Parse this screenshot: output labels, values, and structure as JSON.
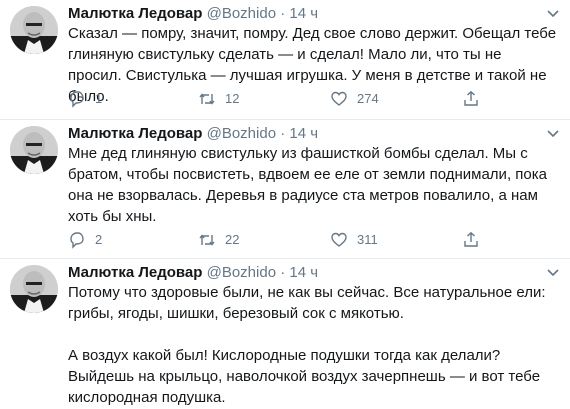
{
  "colors": {
    "text": "#14171a",
    "muted": "#657786",
    "divider": "#e6ecf0"
  },
  "tweets": [
    {
      "author_name": "Малютка Ледовар",
      "handle": "@Bozhido",
      "separator": "·",
      "time": "14 ч",
      "text": "Сказал — помру, значит, помру. Дед свое слово держит. Обещал тебе глиняную свистульку сделать — и сделал! Мало ли, что ты не просил. Свистулька — лучшая игрушка. У меня в детстве и такой не было.",
      "replies": "1",
      "retweets": "12",
      "likes": "274"
    },
    {
      "author_name": "Малютка Ледовар",
      "handle": "@Bozhido",
      "separator": "·",
      "time": "14 ч",
      "text": "Мне дед глиняную свистульку из фашисткой бомбы сделал. Мы с братом, чтобы посвистеть, вдвоем ее еле от земли поднимали, пока она не взорвалась. Деревья в радиусе ста метров повалило, а нам хоть бы хны.",
      "replies": "2",
      "retweets": "22",
      "likes": "311"
    },
    {
      "author_name": "Малютка Ледовар",
      "handle": "@Bozhido",
      "separator": "·",
      "time": "14 ч",
      "text": "Потому что здоровые были, не как вы сейчас. Все натуральное ели: грибы, ягоды, шишки, березовый сок с мякотью.\n\nА воздух какой был! Кислородные подушки тогда как делали? Выйдешь на крыльцо, наволочкой воздух зачерпнешь — и вот тебе кислородная подушка."
    }
  ],
  "icons": {
    "reply": "reply-icon",
    "retweet": "retweet-icon",
    "like": "heart-icon",
    "share": "share-icon",
    "menu": "chevron-down-icon"
  }
}
